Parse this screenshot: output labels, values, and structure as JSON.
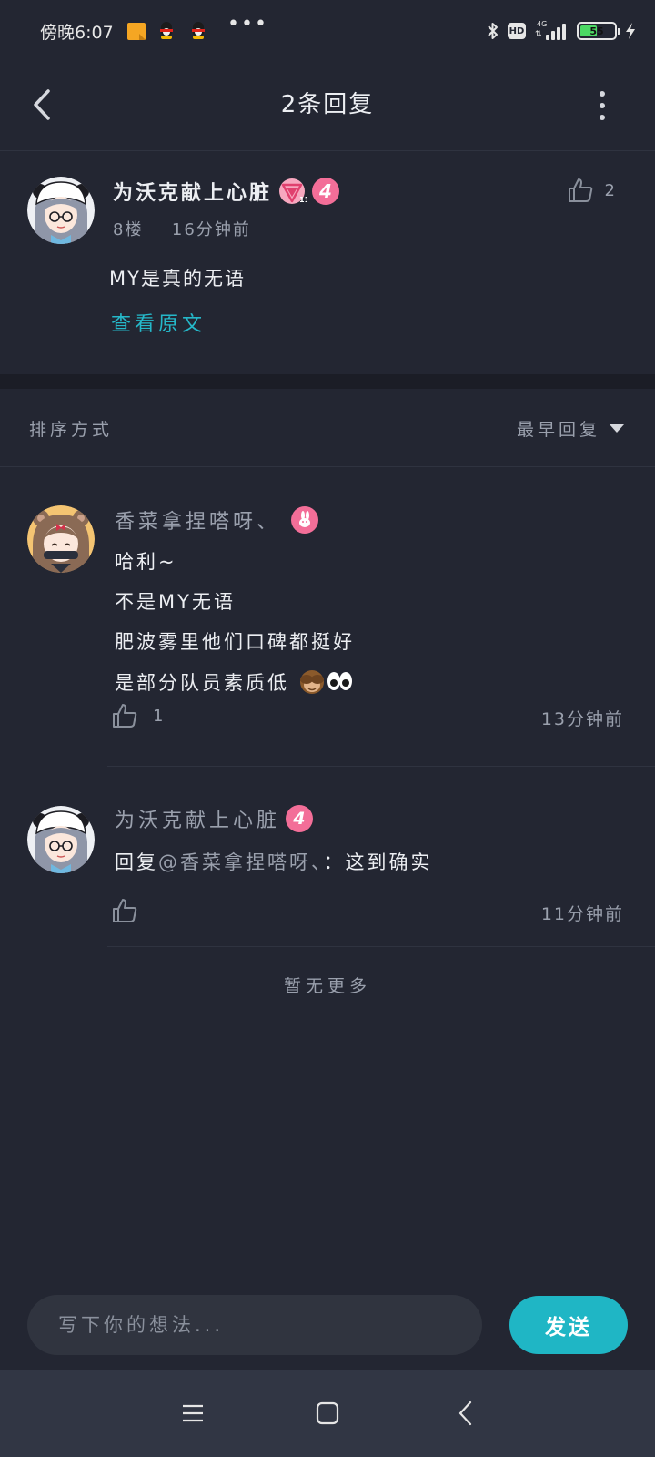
{
  "status_bar": {
    "time": "傍晚6:07",
    "more_dots": "•••",
    "hd": "HD",
    "network": "4G",
    "network_arrows": "⇅",
    "battery_pct": "55",
    "battery_level": 0.55
  },
  "header": {
    "title": "2条回复"
  },
  "parent_comment": {
    "author": "为沃克献上心脏",
    "level": "4",
    "floor": "8楼",
    "time": "16分钟前",
    "text": "MY是真的无语",
    "view_original": "查看原文",
    "likes": "2"
  },
  "sort": {
    "label": "排序方式",
    "selected": "最早回复"
  },
  "replies": [
    {
      "author": "香菜拿捏嗒呀、",
      "lines": [
        "哈利~",
        "不是MY无语",
        "肥波雾里他们口碑都挺好",
        "是部分队员素质低"
      ],
      "likes": "1",
      "time": "13分钟前"
    },
    {
      "author": "为沃克献上心脏",
      "level": "4",
      "reply_prefix": "回复",
      "mention": "@香菜拿捏嗒呀、",
      "text": "：这到确实",
      "time": "11分钟前"
    }
  ],
  "no_more": "暂无更多",
  "input": {
    "placeholder": "写下你的想法...",
    "send_label": "发送"
  },
  "colors": {
    "background": "#232632",
    "accent": "#1fb6c5",
    "link": "#25b8c9",
    "level_badge": "#f36e98"
  }
}
